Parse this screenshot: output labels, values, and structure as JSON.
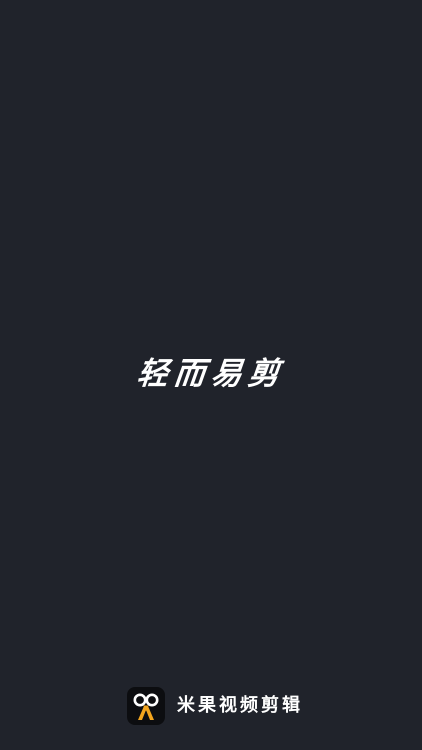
{
  "splash": {
    "slogan": "轻而易剪"
  },
  "brand": {
    "app_name": "米果视频剪辑",
    "icon": "scissors-face-logo-icon"
  },
  "colors": {
    "background": "#20232b",
    "text": "#ffffff",
    "icon_background": "#0c0d10",
    "icon_accent": "#f2a51e"
  }
}
